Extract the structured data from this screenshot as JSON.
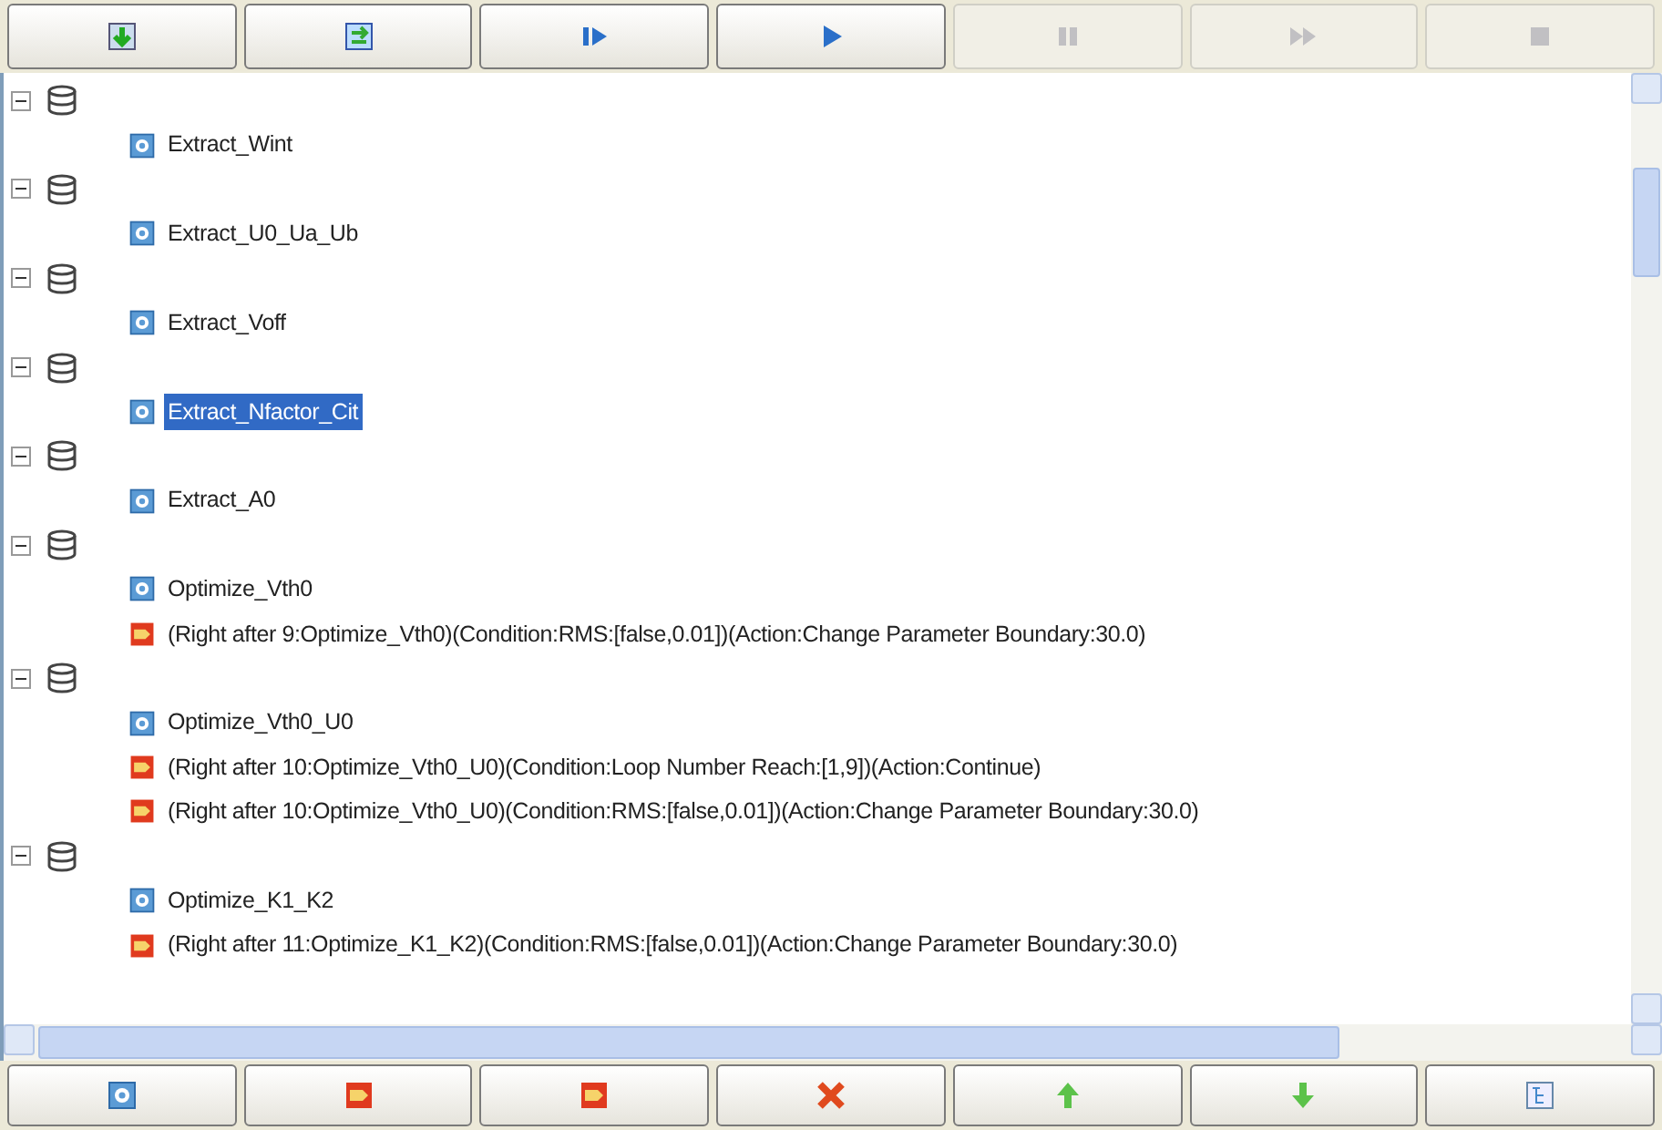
{
  "toolbar": [
    {
      "kind": "import",
      "disabled": false
    },
    {
      "kind": "convert",
      "disabled": false
    },
    {
      "kind": "stepstart",
      "disabled": false
    },
    {
      "kind": "run",
      "disabled": false
    },
    {
      "kind": "pause",
      "disabled": true
    },
    {
      "kind": "forward",
      "disabled": true
    },
    {
      "kind": "stop",
      "disabled": true
    }
  ],
  "tree": [
    {
      "expanded": true,
      "children": [
        {
          "kind": "step",
          "label": "Extract_Wint",
          "selected": false
        }
      ]
    },
    {
      "expanded": true,
      "children": [
        {
          "kind": "step",
          "label": "Extract_U0_Ua_Ub",
          "selected": false
        }
      ]
    },
    {
      "expanded": true,
      "children": [
        {
          "kind": "step",
          "label": "Extract_Voff",
          "selected": false
        }
      ]
    },
    {
      "expanded": true,
      "children": [
        {
          "kind": "step",
          "label": "Extract_Nfactor_Cit",
          "selected": true
        }
      ]
    },
    {
      "expanded": true,
      "children": [
        {
          "kind": "step",
          "label": "Extract_A0",
          "selected": false
        }
      ]
    },
    {
      "expanded": true,
      "children": [
        {
          "kind": "step",
          "label": "Optimize_Vth0",
          "selected": false
        },
        {
          "kind": "rule",
          "label": "(Right after 9:Optimize_Vth0)(Condition:RMS:[false,0.01])(Action:Change Parameter Boundary:30.0)",
          "selected": false
        }
      ]
    },
    {
      "expanded": true,
      "children": [
        {
          "kind": "step",
          "label": "Optimize_Vth0_U0",
          "selected": false
        },
        {
          "kind": "rule",
          "label": "(Right after 10:Optimize_Vth0_U0)(Condition:Loop Number Reach:[1,9])(Action:Continue)",
          "selected": false
        },
        {
          "kind": "rule",
          "label": "(Right after 10:Optimize_Vth0_U0)(Condition:RMS:[false,0.01])(Action:Change Parameter Boundary:30.0)",
          "selected": false
        }
      ]
    },
    {
      "expanded": true,
      "children": [
        {
          "kind": "step",
          "label": "Optimize_K1_K2",
          "selected": false
        },
        {
          "kind": "rule",
          "label": "(Right after 11:Optimize_K1_K2)(Condition:RMS:[false,0.01])(Action:Change Parameter Boundary:30.0)",
          "selected": false
        }
      ]
    }
  ],
  "bottom_toolbar": [
    {
      "kind": "step",
      "disabled": false
    },
    {
      "kind": "rule",
      "disabled": false
    },
    {
      "kind": "rule",
      "disabled": false
    },
    {
      "kind": "delete",
      "disabled": false
    },
    {
      "kind": "up",
      "disabled": false
    },
    {
      "kind": "down",
      "disabled": false
    },
    {
      "kind": "tree",
      "disabled": false
    }
  ]
}
